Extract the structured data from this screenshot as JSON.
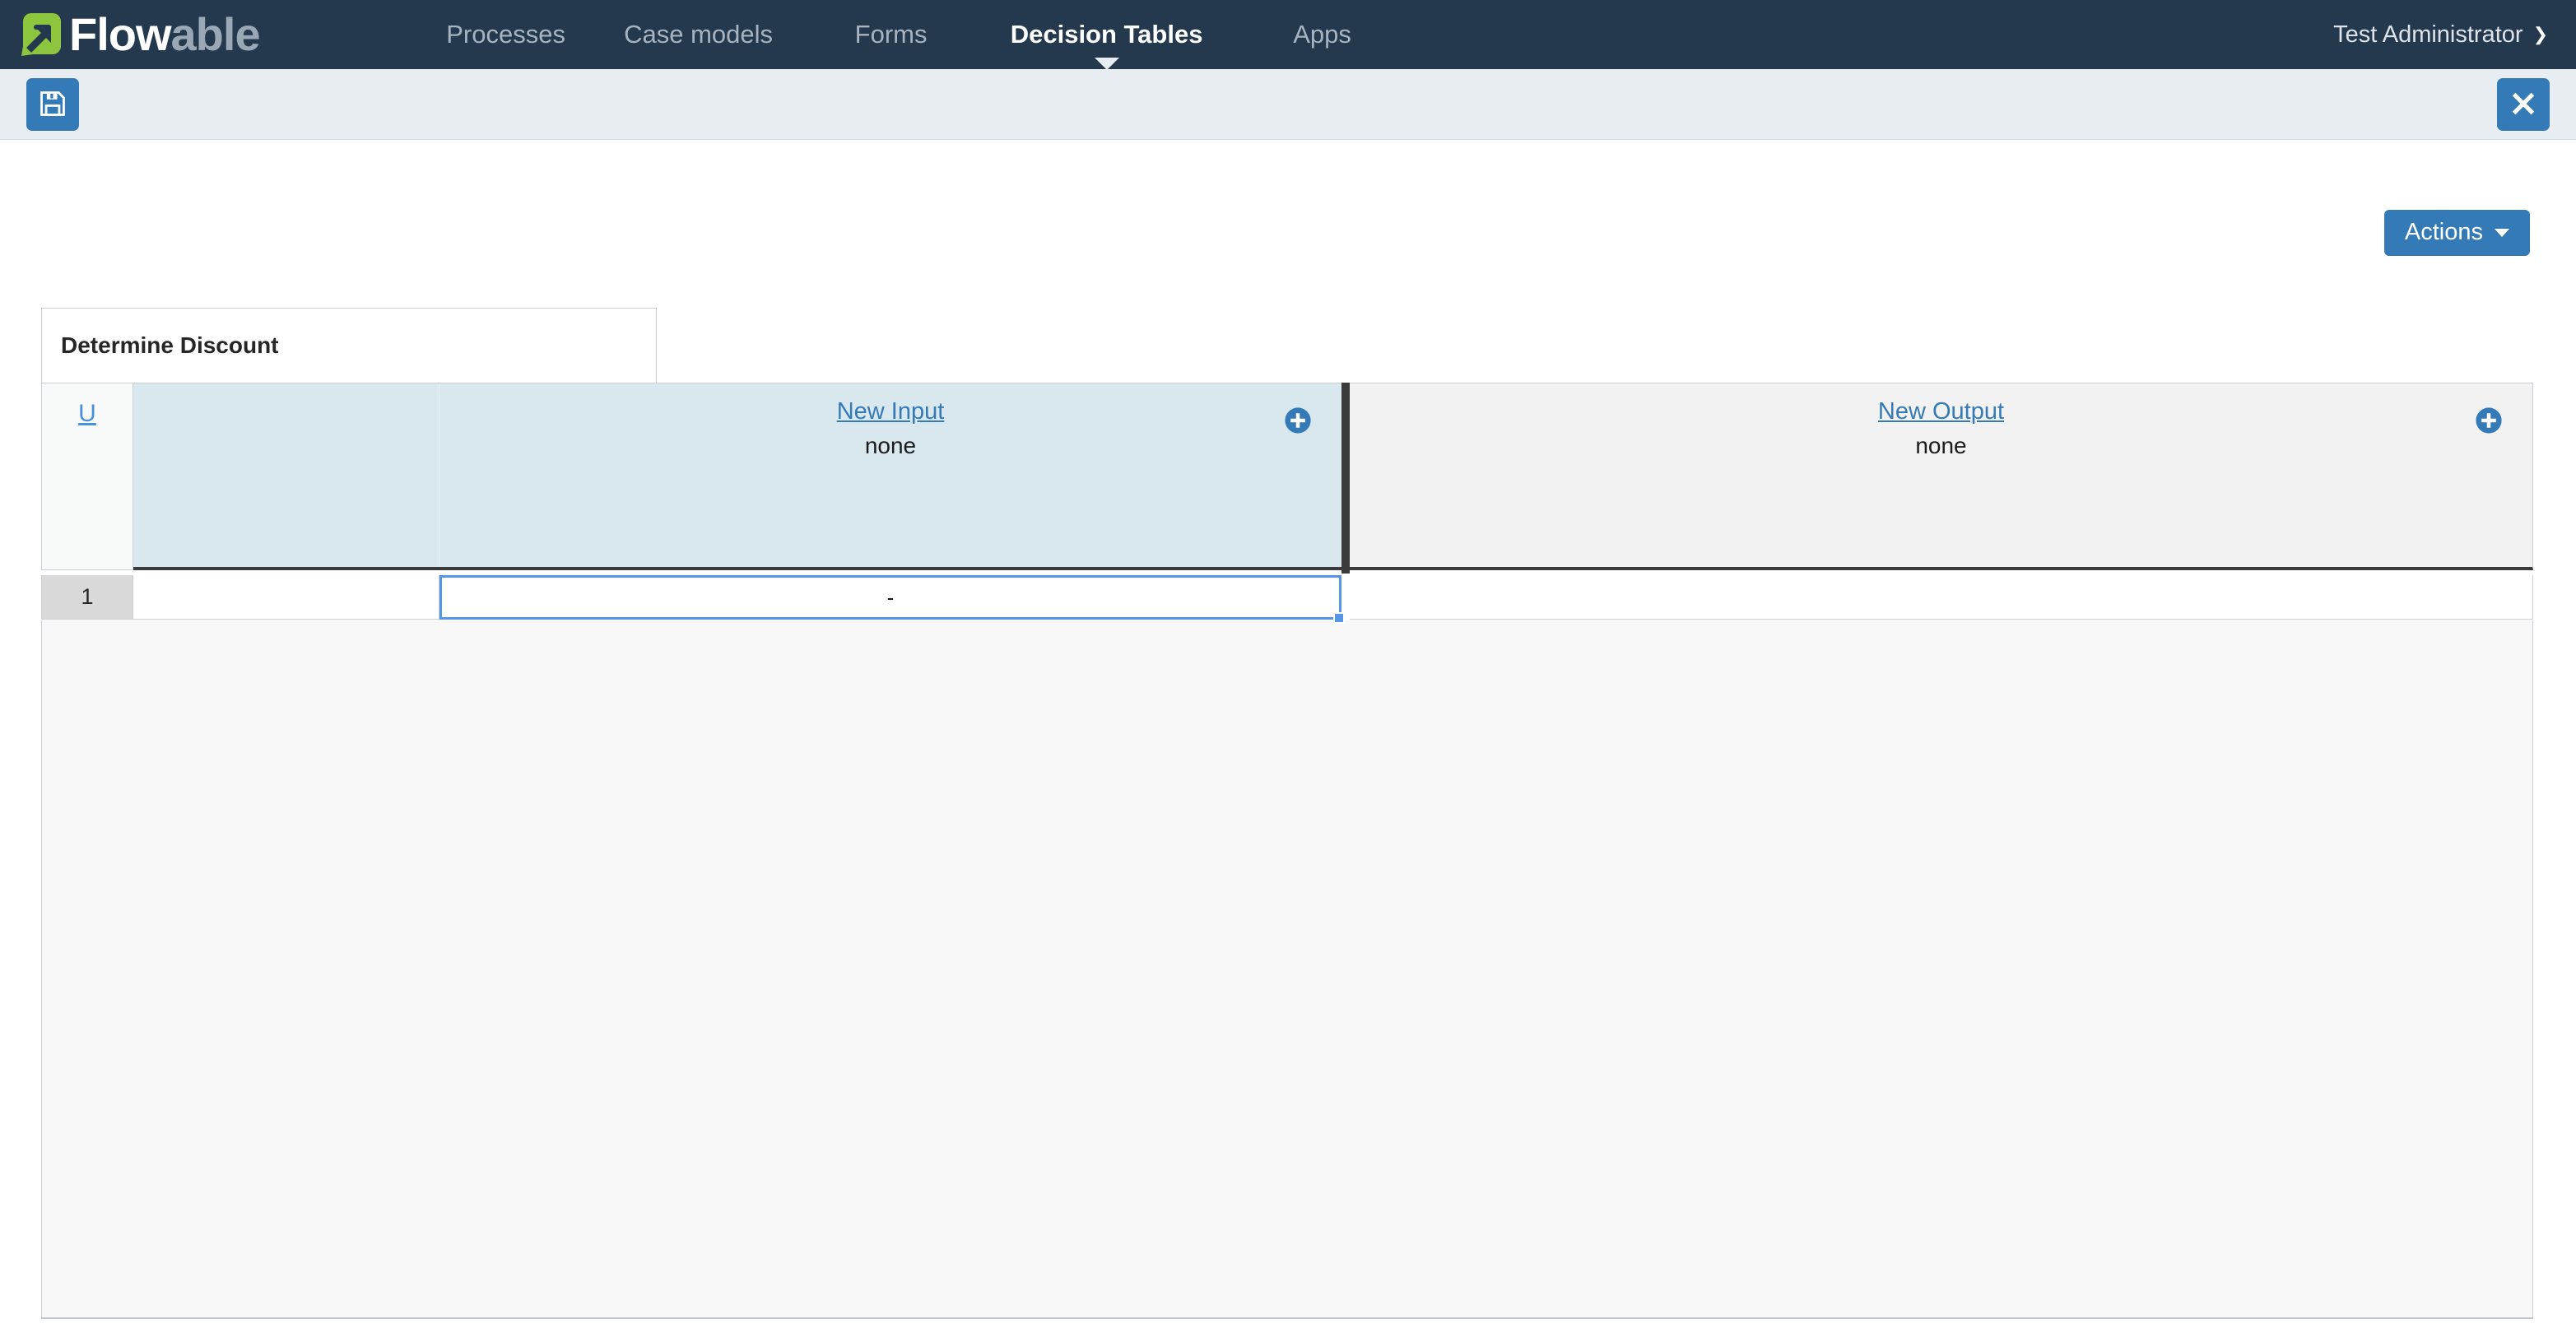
{
  "navbar": {
    "brand": {
      "icon": "flowable-arrow-logo",
      "word_primary": "Flow",
      "word_secondary": "able"
    },
    "items": [
      {
        "label": "Processes",
        "active": false
      },
      {
        "label": "Case models",
        "active": false
      },
      {
        "label": "Forms",
        "active": false
      },
      {
        "label": "Decision Tables",
        "active": true
      },
      {
        "label": "Apps",
        "active": false
      }
    ],
    "user": {
      "name": "Test Administrator",
      "chevron": "chevron-down-icon"
    },
    "background_color": "#24394d",
    "active_text_color": "#ffffff",
    "inactive_text_color": "#a7b3c0"
  },
  "toolbar": {
    "save_icon": "floppy-disk-save-icon",
    "close_icon": "close-x-icon",
    "button_color": "#337ab7",
    "background_color": "#e8edf1"
  },
  "actions": {
    "label": "Actions",
    "caret": "caret-down-icon"
  },
  "decision_table": {
    "title": "Determine Discount",
    "hit_policy": "U",
    "input_section": {
      "columns": [
        {
          "label": "New Input",
          "type": "none",
          "add_icon": "plus-circle-icon"
        }
      ],
      "header_background": "#d9e8ee"
    },
    "output_section": {
      "columns": [
        {
          "label": "New Output",
          "type": "none",
          "add_icon": "plus-circle-icon"
        }
      ],
      "header_background": "#f2f2f2"
    },
    "rows": [
      {
        "number": "1",
        "input_blank": "",
        "input_value": "-",
        "output_value": "",
        "selected_cell": "input_value"
      }
    ],
    "accent_colors": {
      "link": "#337ab7",
      "selection": "#5596e6",
      "divider": "#3b3b3b",
      "row_number_bg": "#d9d9d9"
    }
  }
}
